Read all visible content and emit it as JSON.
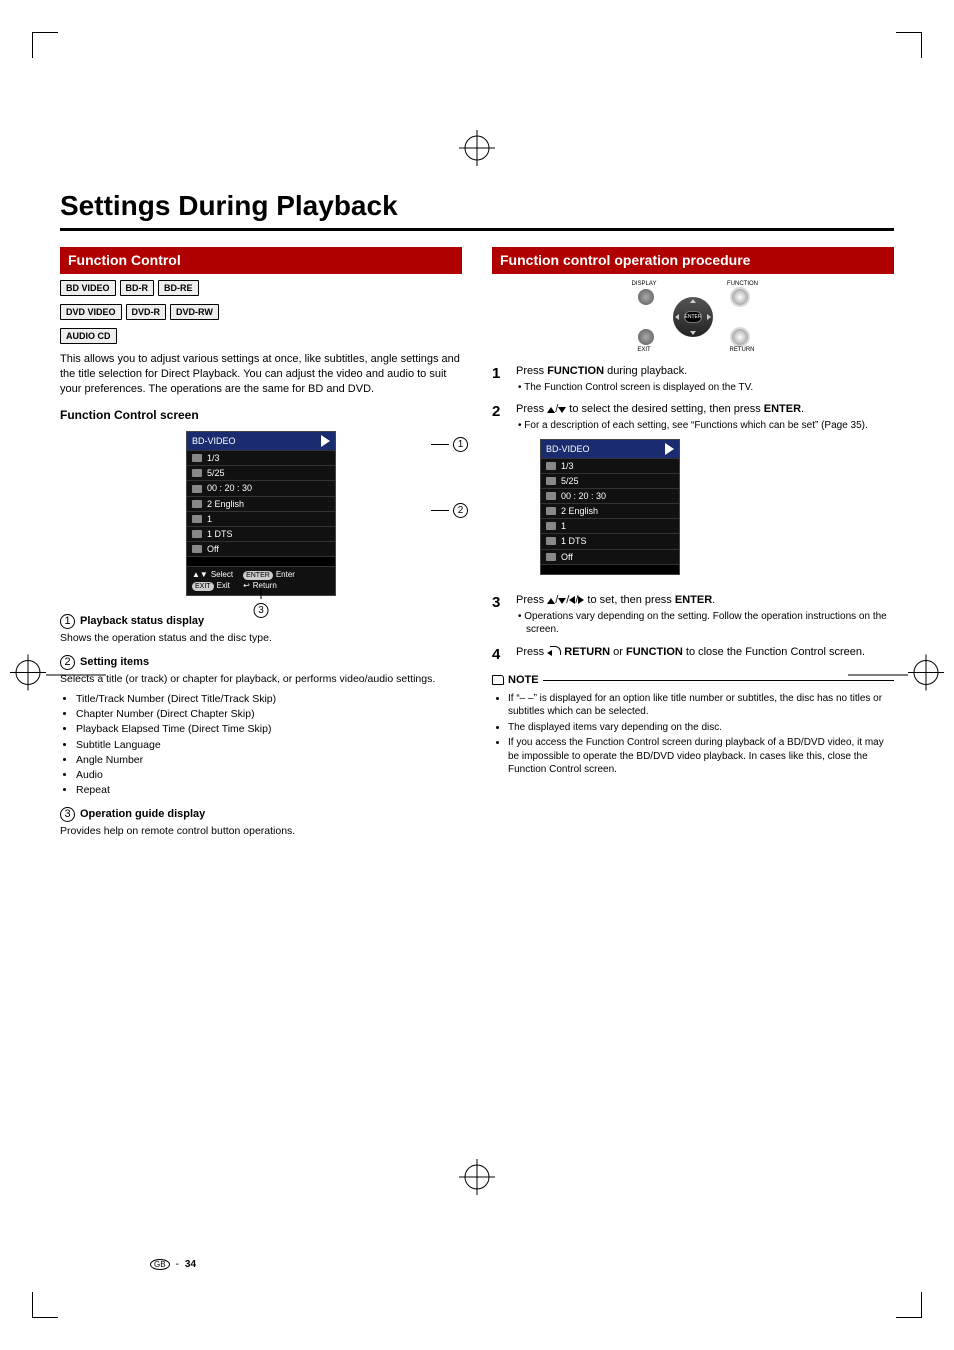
{
  "title": "Settings During Playback",
  "left": {
    "bar": "Function Control",
    "chips": [
      "BD VIDEO",
      "BD-R",
      "BD-RE",
      "DVD VIDEO",
      "DVD-R",
      "DVD-RW",
      "AUDIO CD"
    ],
    "intro": "This allows you to adjust various settings at once, like subtitles, angle settings and the title selection for Direct Playback. You can adjust the video and audio to suit your preferences. The operations are the same for BD and DVD.",
    "subhead": "Function Control screen",
    "osd": {
      "header": "BD-VIDEO",
      "rows": [
        "1/3",
        "5/25",
        "00 : 20 : 30",
        "2 English",
        "1",
        "1 DTS",
        "Off"
      ],
      "guide": {
        "select": "Select",
        "enter": "Enter",
        "exit": "Exit",
        "return": "Return",
        "enter_key": "ENTER",
        "exit_key": "EXIT"
      }
    },
    "sections": [
      {
        "num": "1",
        "title": "Playback status display",
        "desc": "Shows the operation status and the disc type."
      },
      {
        "num": "2",
        "title": "Setting items",
        "desc": "Selects a title (or track) or chapter for playback, or performs video/audio settings.",
        "items": [
          "Title/Track Number (Direct Title/Track Skip)",
          "Chapter Number (Direct Chapter Skip)",
          "Playback Elapsed Time (Direct Time Skip)",
          "Subtitle Language",
          "Angle Number",
          "Audio",
          "Repeat"
        ]
      },
      {
        "num": "3",
        "title": "Operation guide display",
        "desc": "Provides help on remote control button operations."
      }
    ]
  },
  "right": {
    "bar": "Function control operation procedure",
    "remote": {
      "display": "DISPLAY",
      "function": "FUNCTION",
      "exit": "EXIT",
      "return": "RETURN",
      "enter": "ENTER"
    },
    "steps": [
      {
        "n": "1",
        "body_pre": "Press ",
        "body_b": "FUNCTION",
        "body_post": " during playback.",
        "subs": [
          "The Function Control screen is displayed on the TV."
        ]
      },
      {
        "n": "2",
        "body_pre": "Press ",
        "arrows": "ud",
        "body_mid": " to select the desired setting, then press ",
        "body_b": "ENTER",
        "body_post": ".",
        "subs": [
          "For a description of each setting, see “Functions which can be set” (Page 35)."
        ]
      },
      {
        "n": "3",
        "body_pre": "Press ",
        "arrows": "udlr",
        "body_mid": " to set, then press ",
        "body_b": "ENTER",
        "body_post": ".",
        "subs": [
          "Operations vary depending on the setting. Follow the operation instructions on the screen."
        ]
      },
      {
        "n": "4",
        "body_pre": "Press ",
        "ret": true,
        "body_b": "RETURN",
        "body_mid2": " or ",
        "body_b2": "FUNCTION",
        "body_post": " to close the Function Control screen."
      }
    ],
    "osd2": {
      "header": "BD-VIDEO",
      "rows": [
        "1/3",
        "5/25",
        "00 : 20 : 30",
        "2 English",
        "1",
        "1 DTS",
        "Off"
      ]
    },
    "note_label": "NOTE",
    "notes": [
      "If “– –” is displayed for an option like title number or subtitles, the disc has no titles or subtitles which can be selected.",
      "The displayed items vary depending on the disc.",
      "If you access the Function Control screen during playback of a BD/DVD video, it may be impossible to operate the BD/DVD video playback. In cases like this, close the Function Control screen."
    ]
  },
  "footer": {
    "gb": "GB",
    "page": "34"
  }
}
